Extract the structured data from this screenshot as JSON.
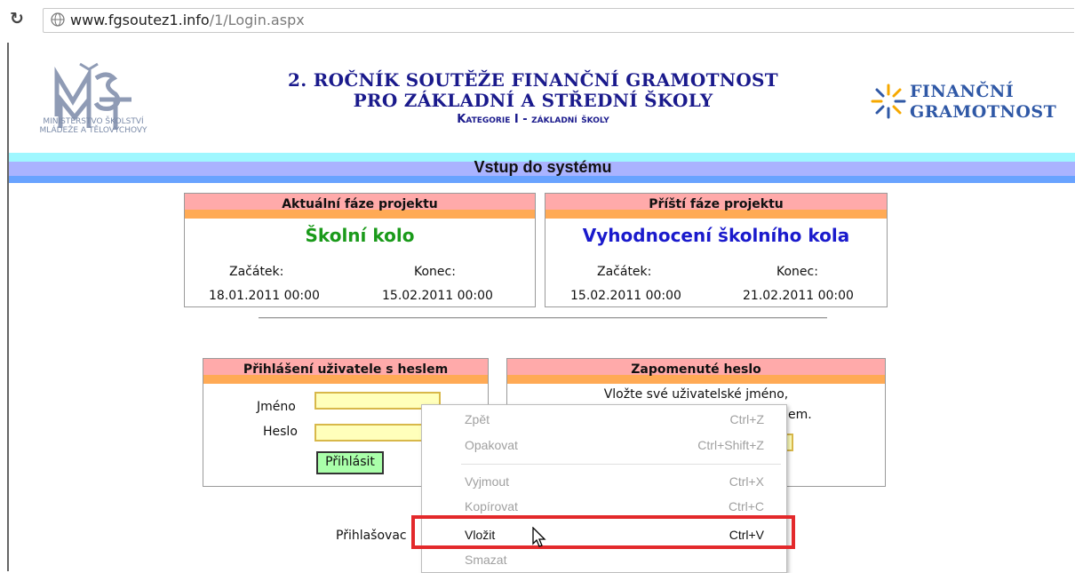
{
  "browser": {
    "url_host": "www.fgsoutez1.info",
    "url_path": "/1/Login.aspx"
  },
  "header": {
    "left_logo_caption_1": "MINISTERSTVO ŠKOLSTVÍ",
    "left_logo_caption_2": "MLÁDEŽE A TĚLOVÝCHOVY",
    "title_line1": "2. ROČNÍK SOUTĚŽE FINANČNÍ GRAMOTNOST",
    "title_line2": "PRO ZÁKLADNÍ A STŘEDNÍ ŠKOLY",
    "title_line3": "Kategorie I - základní školy",
    "right_logo_line1": "FINANČNÍ",
    "right_logo_line2": "GRAMOTNOST"
  },
  "section_title": "Vstup do systému",
  "current_phase": {
    "heading": "Aktuální fáze projektu",
    "name": "Školní kolo",
    "start_label": "Začátek:",
    "end_label": "Konec:",
    "start": "18.01.2011 00:00",
    "end": "15.02.2011 00:00",
    "color": "#1a9a1a"
  },
  "next_phase": {
    "heading": "Příští fáze projektu",
    "name": "Vyhodnocení školního kola",
    "start_label": "Začátek:",
    "end_label": "Konec:",
    "start": "15.02.2011 00:00",
    "end": "21.02.2011 00:00",
    "color": "#1a1acc"
  },
  "login": {
    "heading": "Přihlášení uživatele s heslem",
    "name_label": "Jméno",
    "password_label": "Heslo",
    "submit_label": "Přihlásit"
  },
  "forgot": {
    "heading": "Zapomenuté heslo",
    "line1": "Vložte své uživatelské jméno,",
    "line2_fragment": "em."
  },
  "footer_fragment": "Přihlašovac",
  "context_menu": {
    "items": [
      {
        "label": "Zpět",
        "shortcut": "Ctrl+Z",
        "enabled": false
      },
      {
        "label": "Opakovat",
        "shortcut": "Ctrl+Shift+Z",
        "enabled": false
      },
      {
        "label": "Vyjmout",
        "shortcut": "Ctrl+X",
        "enabled": false
      },
      {
        "label": "Kopírovat",
        "shortcut": "Ctrl+C",
        "enabled": false
      },
      {
        "label": "Vložit",
        "shortcut": "Ctrl+V",
        "enabled": true
      },
      {
        "label": "Smazat",
        "shortcut": "",
        "enabled": false
      }
    ]
  },
  "colors": {
    "title": "#1a1a8c",
    "highlight": "#e3292b"
  }
}
